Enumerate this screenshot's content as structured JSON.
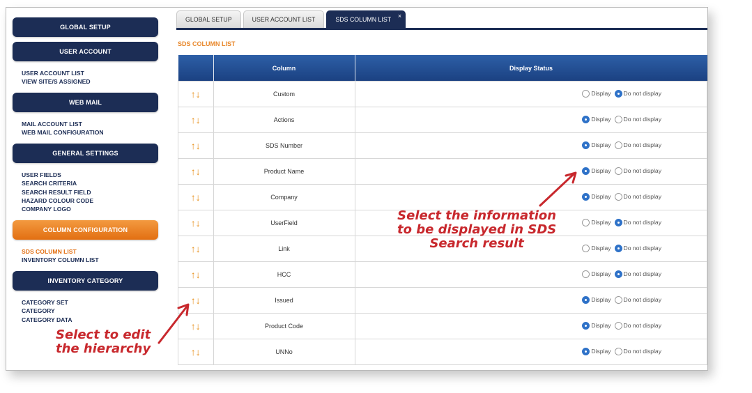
{
  "sidebar": {
    "global_setup": "GLOBAL SETUP",
    "user_account": "USER ACCOUNT",
    "user_account_items": [
      "USER ACCOUNT LIST",
      "VIEW SITE/S ASSIGNED"
    ],
    "web_mail": "WEB MAIL",
    "web_mail_items": [
      "MAIL ACCOUNT LIST",
      "WEB MAIL CONFIGURATION"
    ],
    "general_settings": "GENERAL SETTINGS",
    "general_settings_items": [
      "USER FIELDS",
      "SEARCH CRITERIA",
      "SEARCH RESULT FIELD",
      "HAZARD COLOUR CODE",
      "COMPANY LOGO"
    ],
    "column_configuration": "COLUMN CONFIGURATION",
    "column_configuration_items": [
      "SDS COLUMN LIST",
      "INVENTORY COLUMN LIST"
    ],
    "inventory_category": "INVENTORY CATEGORY",
    "inventory_category_items": [
      "CATEGORY SET",
      "CATEGORY",
      "CATEGORY DATA"
    ]
  },
  "tabs": [
    "GLOBAL SETUP",
    "USER ACCOUNT LIST",
    "SDS COLUMN LIST"
  ],
  "tab_close": "×",
  "page_title": "SDS COLUMN LIST",
  "table": {
    "headers": [
      "",
      "Column",
      "Display Status"
    ],
    "arrow_glyph": "↑↓",
    "display_label": "Display",
    "hide_label": "Do not display",
    "rows": [
      {
        "name": "Custom",
        "display": false
      },
      {
        "name": "Actions",
        "display": true
      },
      {
        "name": "SDS Number",
        "display": true
      },
      {
        "name": "Product Name",
        "display": true
      },
      {
        "name": "Company",
        "display": true
      },
      {
        "name": "UserField",
        "display": false
      },
      {
        "name": "Link",
        "display": false
      },
      {
        "name": "HCC",
        "display": false
      },
      {
        "name": "Issued",
        "display": true
      },
      {
        "name": "Product Code",
        "display": true
      },
      {
        "name": "UNNo",
        "display": true
      }
    ]
  },
  "annotations": {
    "info_lines": [
      "Select the information",
      "to be displayed in SDS",
      "Search result"
    ],
    "hierarchy_lines": [
      "Select to edit",
      "the hierarchy"
    ]
  },
  "colors": {
    "navy": "#1c2d55",
    "orange": "#e8872a",
    "annotation_red": "#c8282d",
    "radio_blue": "#2f72c8"
  }
}
